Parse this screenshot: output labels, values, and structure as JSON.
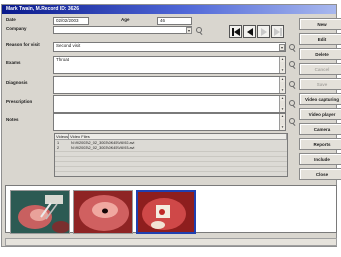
{
  "window": {
    "title": "Mark Twain, M.Record ID: 3626"
  },
  "form": {
    "date_label": "Date",
    "date_value": "02/02/2003",
    "age_label": "Age",
    "age_value": "46",
    "company_label": "Company",
    "company_value": "",
    "reason_label": "Reason for visit",
    "reason_value": "Second visit",
    "exams_label": "Exams",
    "exams_value": "Throat",
    "diagnosis_label": "Diagnosis",
    "diagnosis_value": "",
    "prescription_label": "Prescription",
    "prescription_value": "",
    "notes_label": "Notes",
    "notes_value": ""
  },
  "nav": {
    "first_icon": "first-record-icon",
    "prev_icon": "previous-record-icon",
    "next_icon": "next-record-icon",
    "last_icon": "last-record-icon"
  },
  "video_files": {
    "headers": [
      "Videos",
      "Video Files"
    ],
    "rows": [
      {
        "index": "1",
        "file": "N:\\9\\2003\\2_02_3003\\0K45\\V6\\92.avi"
      },
      {
        "index": "2",
        "file": "N:\\9\\2003\\2_02_3003\\0K45\\V6\\93.avi"
      }
    ]
  },
  "buttons": {
    "new": "New",
    "edit": "Edit",
    "delete": "Delete",
    "cancel": "Cancel",
    "save": "Save",
    "video_capturing": "Video capturing",
    "video_player": "Video player",
    "camera": "Camera",
    "reports": "Reports",
    "include": "Include",
    "close": "Close"
  },
  "button_states": {
    "cancel": "disabled",
    "save": "disabled"
  },
  "colors": {
    "title_bar": "#0a1a8c",
    "window_bg": "#d9d6cf",
    "selected_thumb_border": "#1f3fb0"
  }
}
